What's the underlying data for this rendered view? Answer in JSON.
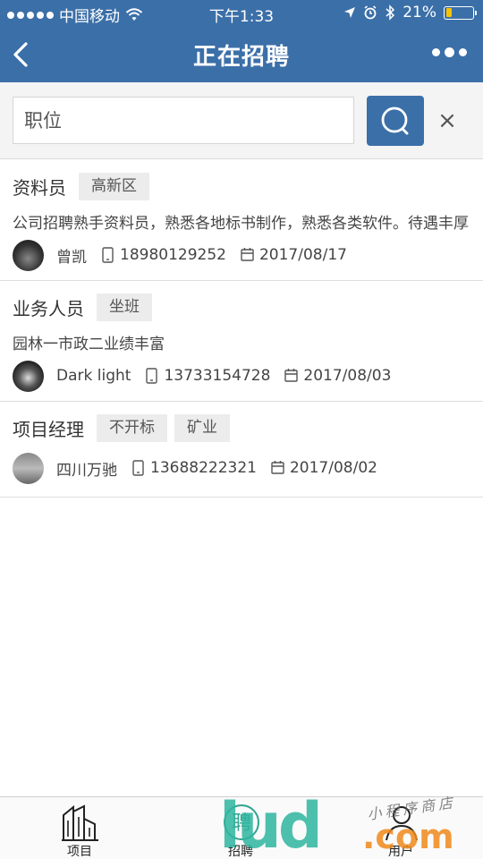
{
  "status_bar": {
    "carrier": "中国移动",
    "time": "下午1:33",
    "battery": "21%",
    "battery_level": 0.21
  },
  "nav": {
    "title": "正在招聘"
  },
  "search": {
    "placeholder": "职位",
    "clear": "×"
  },
  "jobs": [
    {
      "title": "资料员",
      "tags": [
        "高新区"
      ],
      "description": "公司招聘熟手资料员，熟悉各地标书制作，熟悉各类软件。待遇丰厚",
      "contact": "曾凯",
      "phone": "18980129252",
      "date": "2017/08/17"
    },
    {
      "title": "业务人员",
      "tags": [
        "坐班"
      ],
      "description": "园林一市政二业绩丰富",
      "contact": "Dark light",
      "phone": "13733154728",
      "date": "2017/08/03"
    },
    {
      "title": "项目经理",
      "tags": [
        "不开标",
        "矿业"
      ],
      "description": "",
      "contact": "四川万驰",
      "phone": "13688222321",
      "date": "2017/08/02"
    }
  ],
  "tabs": [
    {
      "label": "项目",
      "icon": "buildings-icon"
    },
    {
      "label": "招聘",
      "icon": "hire-icon"
    },
    {
      "label": "用户",
      "icon": "user-icon"
    }
  ],
  "watermark": {
    "brand": "lud",
    "suffix": ".com",
    "script": "小程序商店"
  },
  "colors": {
    "primary": "#3b6fa8",
    "tag_bg": "#ececec"
  }
}
